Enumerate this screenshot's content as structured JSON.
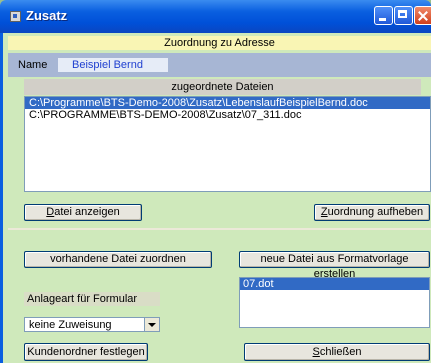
{
  "window": {
    "title": "Zusatz"
  },
  "header": {
    "title": "Zuordnung zu Adresse"
  },
  "name_row": {
    "label": "Name",
    "value": "Beispiel Bernd"
  },
  "files": {
    "header": "zugeordnete Dateien",
    "items": [
      {
        "path": "C:\\Programme\\BTS-Demo-2008\\Zusatz\\LebenslaufBeispielBernd.doc",
        "selected": true
      },
      {
        "path": "C:\\PROGRAMME\\BTS-DEMO-2008\\Zusatz\\07_311.doc",
        "selected": false
      }
    ]
  },
  "buttons": {
    "datei_anzeigen": {
      "hotkey": "D",
      "rest": "atei anzeigen"
    },
    "zuordnung_aufheben": {
      "hotkey": "Z",
      "rest": "uordnung aufheben"
    },
    "vorhandene_datei": "vorhandene Datei zuordnen",
    "neue_datei": "neue Datei aus Formatvorlage erstellen",
    "kundenordner": "Kundenordner festlegen",
    "schliessen": {
      "hotkey": "S",
      "rest": "chließen"
    }
  },
  "formular": {
    "label": "Anlageart für Formular",
    "selected": "keine Zuweisung"
  },
  "templates": {
    "items": [
      "07.dot"
    ],
    "selected_index": 0
  },
  "colors": {
    "titlebar": "#0054e3",
    "client": "#cfe9bb",
    "header_band": "#f9f5b4",
    "name_band": "#a7b6d4",
    "selection": "#316ac5"
  }
}
